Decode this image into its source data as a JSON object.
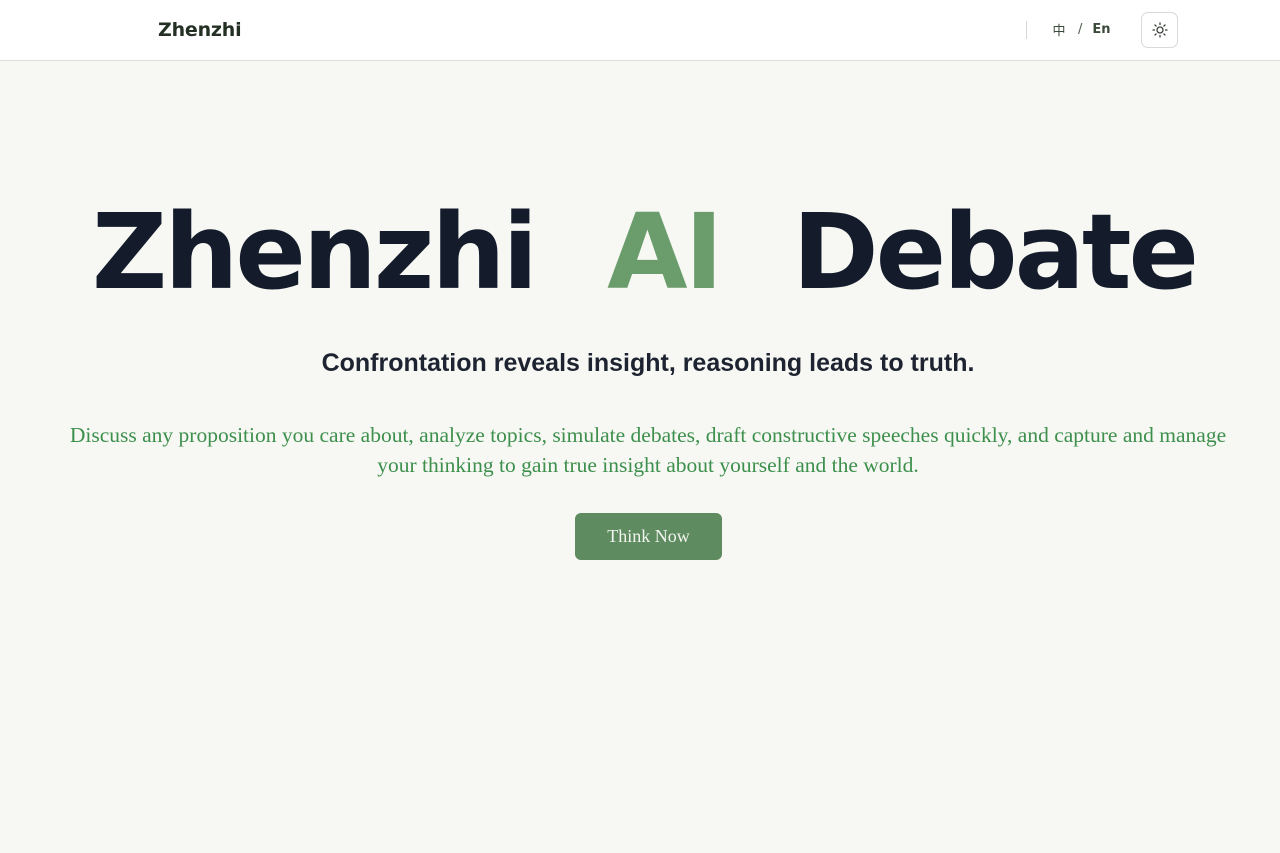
{
  "header": {
    "brand": "Zhenzhi",
    "language": {
      "zh_label": "中",
      "separator": "/",
      "en_label": "En"
    },
    "theme_toggle_icon": "sun-icon"
  },
  "hero": {
    "title_parts": [
      "Zhenzhi",
      "AI",
      "Debate"
    ],
    "tagline": "Confrontation reveals insight, reasoning leads to truth.",
    "description": "Discuss any proposition you care about, analyze topics, simulate debates, draft constructive speeches quickly, and capture and manage your thinking to gain true insight about yourself and the world.",
    "cta_label": "Think Now"
  },
  "colors": {
    "accent": "#6a9d6b",
    "button": "#5e8b5f",
    "description_text": "#3d8f4c",
    "title_text": "#141c2c",
    "background": "#f7f8f4"
  }
}
